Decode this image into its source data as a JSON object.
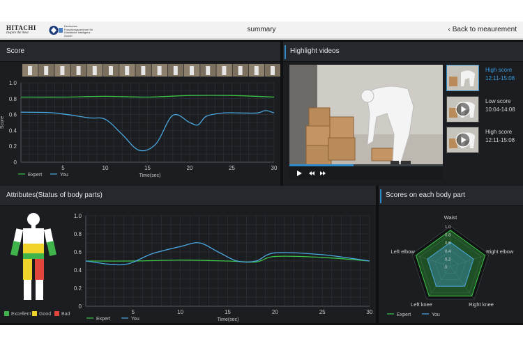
{
  "header": {
    "brand_line1": "HITACHI",
    "brand_line2": "Inspire the Next",
    "partner_text": "Deutsches Forschungszentrum für Künstliche Intelligenz GmbH",
    "title": "summary",
    "back_label": "Back to meaurement"
  },
  "score_panel": {
    "title": "Score",
    "chart": {
      "x_ticks": [
        "5",
        "10",
        "15",
        "20",
        "25",
        "30"
      ],
      "y_ticks": [
        "0",
        "0.2",
        "0.4",
        "0.6",
        "0.8",
        "1.0"
      ],
      "ylabel": "Score",
      "xlabel": "Time(sec)",
      "legend": [
        {
          "name": "Expert",
          "color": "#3cc448"
        },
        {
          "name": "You",
          "color": "#4aa8e0"
        }
      ]
    }
  },
  "highlight_panel": {
    "title": "Highlight videos",
    "list": [
      {
        "label": "High score",
        "time": "12:11-15:08",
        "active": true
      },
      {
        "label": "Low score",
        "time": "10:04-14:08",
        "active": false
      },
      {
        "label": "High score",
        "time": "12:11-15:08",
        "active": false
      }
    ]
  },
  "attributes_panel": {
    "title": "Attributes(Status of body parts)",
    "status_legend": [
      {
        "label": "Excellent",
        "color": "#3fb44a"
      },
      {
        "label": "Good",
        "color": "#f0d22a"
      },
      {
        "label": "Bad",
        "color": "#e0463a"
      }
    ],
    "chart": {
      "x_ticks": [
        "5",
        "10",
        "15",
        "20",
        "25",
        "30"
      ],
      "y_ticks": [
        "0",
        "0.2",
        "0.4",
        "0.6",
        "0.8",
        "1.0"
      ],
      "ylabel": "Score",
      "xlabel": "Time(sec)",
      "legend": [
        {
          "name": "Expert",
          "color": "#3cc448"
        },
        {
          "name": "You",
          "color": "#4aa8e0"
        }
      ]
    }
  },
  "bodypart_panel": {
    "title": "Scores on each body part",
    "axes": [
      "Waist",
      "Right elbow",
      "Right knee",
      "Left knee",
      "Left elbow"
    ],
    "ticks": [
      "1.0",
      "0.8",
      "0.6",
      "0.4",
      "0.2",
      "0"
    ],
    "legend": [
      {
        "name": "Expert",
        "color": "#3cc448"
      },
      {
        "name": "You",
        "color": "#4aa8e0"
      }
    ]
  },
  "chart_data": [
    {
      "type": "line",
      "xlabel": "Time(sec)",
      "ylabel": "Score",
      "xlim": [
        0,
        30
      ],
      "ylim": [
        0,
        1.0
      ],
      "series": [
        {
          "name": "Expert",
          "x": [
            0,
            5,
            10,
            15,
            20,
            25,
            30
          ],
          "values": [
            0.82,
            0.82,
            0.83,
            0.82,
            0.84,
            0.84,
            0.82
          ]
        },
        {
          "name": "You",
          "x": [
            0,
            4,
            8,
            10,
            12,
            14,
            16,
            18,
            20,
            21,
            22,
            24,
            26,
            28,
            29,
            30
          ],
          "values": [
            0.63,
            0.62,
            0.56,
            0.54,
            0.35,
            0.15,
            0.23,
            0.59,
            0.5,
            0.47,
            0.58,
            0.62,
            0.62,
            0.62,
            0.65,
            0.62
          ]
        }
      ]
    },
    {
      "type": "line",
      "xlabel": "Time(sec)",
      "ylabel": "Score",
      "xlim": [
        0,
        30
      ],
      "ylim": [
        0,
        1.0
      ],
      "series": [
        {
          "name": "Expert",
          "x": [
            0,
            5,
            10,
            15,
            18,
            20,
            25,
            30
          ],
          "values": [
            0.5,
            0.5,
            0.51,
            0.5,
            0.49,
            0.55,
            0.54,
            0.5
          ]
        },
        {
          "name": "You",
          "x": [
            0,
            4,
            7,
            10,
            12,
            14,
            16,
            18,
            20,
            25,
            30
          ],
          "values": [
            0.5,
            0.46,
            0.58,
            0.66,
            0.7,
            0.6,
            0.5,
            0.5,
            0.59,
            0.57,
            0.5
          ]
        }
      ]
    },
    {
      "type": "radar",
      "categories": [
        "Waist",
        "Right elbow",
        "Right knee",
        "Left knee",
        "Left elbow"
      ],
      "rlim": [
        0,
        1.0
      ],
      "series": [
        {
          "name": "Expert",
          "values": [
            0.9,
            0.9,
            0.9,
            0.9,
            0.9
          ]
        },
        {
          "name": "You",
          "values": [
            0.6,
            0.6,
            0.6,
            0.6,
            0.6
          ]
        }
      ]
    }
  ]
}
